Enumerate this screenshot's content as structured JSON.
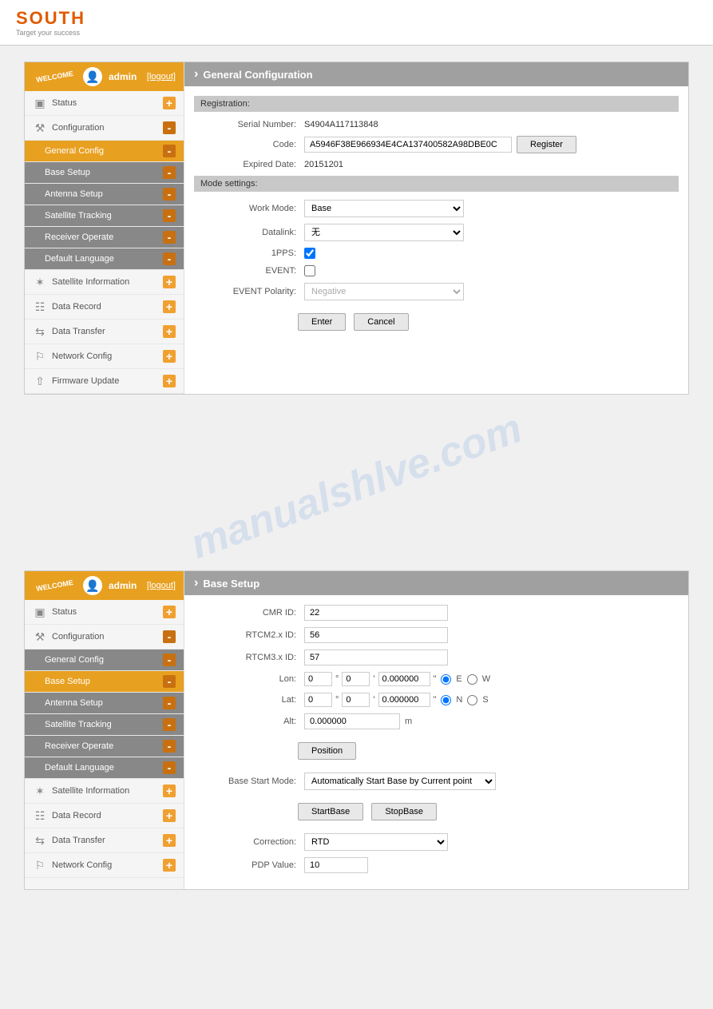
{
  "header": {
    "logo": "SOUTH",
    "tagline": "Target your success"
  },
  "panel1": {
    "sidebar": {
      "welcome": "WELCOME",
      "username": "admin",
      "logout": "[logout]",
      "items": [
        {
          "id": "status",
          "label": "Status",
          "icon": "monitor",
          "toggle": "plus"
        },
        {
          "id": "configuration",
          "label": "Configuration",
          "icon": "wrench",
          "toggle": "minus",
          "expanded": true
        },
        {
          "id": "general-config",
          "label": "General Config",
          "sub": true,
          "toggle": "minus",
          "active": true
        },
        {
          "id": "base-setup",
          "label": "Base Setup",
          "sub": true,
          "toggle": "minus"
        },
        {
          "id": "antenna-setup",
          "label": "Antenna Setup",
          "sub": true,
          "toggle": "minus"
        },
        {
          "id": "satellite-tracking",
          "label": "Satellite Tracking",
          "sub": true,
          "toggle": "minus"
        },
        {
          "id": "receiver-operate",
          "label": "Receiver Operate",
          "sub": true,
          "toggle": "minus"
        },
        {
          "id": "default-language",
          "label": "Default Language",
          "sub": true,
          "toggle": "minus"
        },
        {
          "id": "satellite-info",
          "label": "Satellite Information",
          "icon": "star",
          "toggle": "plus"
        },
        {
          "id": "data-record",
          "label": "Data Record",
          "icon": "grid",
          "toggle": "plus"
        },
        {
          "id": "data-transfer",
          "label": "Data Transfer",
          "icon": "transfer",
          "toggle": "plus"
        },
        {
          "id": "network-config",
          "label": "Network Config",
          "icon": "globe",
          "toggle": "plus"
        },
        {
          "id": "firmware-update",
          "label": "Firmware Update",
          "icon": "upload",
          "toggle": "plus"
        }
      ]
    },
    "main": {
      "title": "General Configuration",
      "registration": {
        "heading": "Registration:",
        "serial_label": "Serial Number:",
        "serial_value": "S4904A117113848",
        "code_label": "Code:",
        "code_value": "A5946F38E966934E4CA137400582A98DBE0C",
        "register_btn": "Register",
        "expired_label": "Expired Date:",
        "expired_value": "20151201"
      },
      "mode_settings": {
        "heading": "Mode settings:",
        "work_mode_label": "Work Mode:",
        "work_mode_value": "Base",
        "datalink_label": "Datalink:",
        "datalink_value": "无",
        "pps_label": "1PPS:",
        "event_label": "EVENT:",
        "event_polarity_label": "EVENT Polarity:",
        "event_polarity_value": "Negative"
      },
      "enter_btn": "Enter",
      "cancel_btn": "Cancel"
    }
  },
  "watermark": "manualshlve.com",
  "panel2": {
    "sidebar": {
      "welcome": "WELCOME",
      "username": "admin",
      "logout": "[logout]",
      "items": [
        {
          "id": "status",
          "label": "Status",
          "icon": "monitor",
          "toggle": "plus"
        },
        {
          "id": "configuration",
          "label": "Configuration",
          "icon": "wrench",
          "toggle": "minus",
          "expanded": true
        },
        {
          "id": "general-config",
          "label": "General Config",
          "sub": true,
          "toggle": "minus"
        },
        {
          "id": "base-setup",
          "label": "Base Setup",
          "sub": true,
          "toggle": "minus",
          "active": true
        },
        {
          "id": "antenna-setup",
          "label": "Antenna Setup",
          "sub": true,
          "toggle": "minus"
        },
        {
          "id": "satellite-tracking",
          "label": "Satellite Tracking",
          "sub": true,
          "toggle": "minus"
        },
        {
          "id": "receiver-operate",
          "label": "Receiver Operate",
          "sub": true,
          "toggle": "minus"
        },
        {
          "id": "default-language",
          "label": "Default Language",
          "sub": true,
          "toggle": "minus"
        },
        {
          "id": "satellite-info",
          "label": "Satellite Information",
          "icon": "star",
          "toggle": "plus"
        },
        {
          "id": "data-record",
          "label": "Data Record",
          "icon": "grid",
          "toggle": "plus"
        },
        {
          "id": "data-transfer",
          "label": "Data Transfer",
          "icon": "transfer",
          "toggle": "plus"
        },
        {
          "id": "network-config",
          "label": "Network Config",
          "icon": "globe",
          "toggle": "plus"
        }
      ]
    },
    "main": {
      "title": "Base Setup",
      "cmr_id_label": "CMR ID:",
      "cmr_id_value": "22",
      "rtcm2_label": "RTCM2.x ID:",
      "rtcm2_value": "56",
      "rtcm3_label": "RTCM3.x ID:",
      "rtcm3_value": "57",
      "lon_label": "Lon:",
      "lon_deg": "0",
      "lon_min": "0",
      "lon_sec": "0.000000",
      "lat_label": "Lat:",
      "lat_deg": "0",
      "lat_min": "0",
      "lat_sec": "0.000000",
      "alt_label": "Alt:",
      "alt_value": "0.000000",
      "alt_unit": "m",
      "position_btn": "Position",
      "base_start_mode_label": "Base Start Mode:",
      "base_start_mode_value": "Automatically Start Base by Current point",
      "startbase_btn": "StartBase",
      "stopbase_btn": "StopBase",
      "correction_label": "Correction:",
      "correction_value": "RTD",
      "pdop_label": "PDP Value:",
      "pdop_value": "10"
    }
  }
}
